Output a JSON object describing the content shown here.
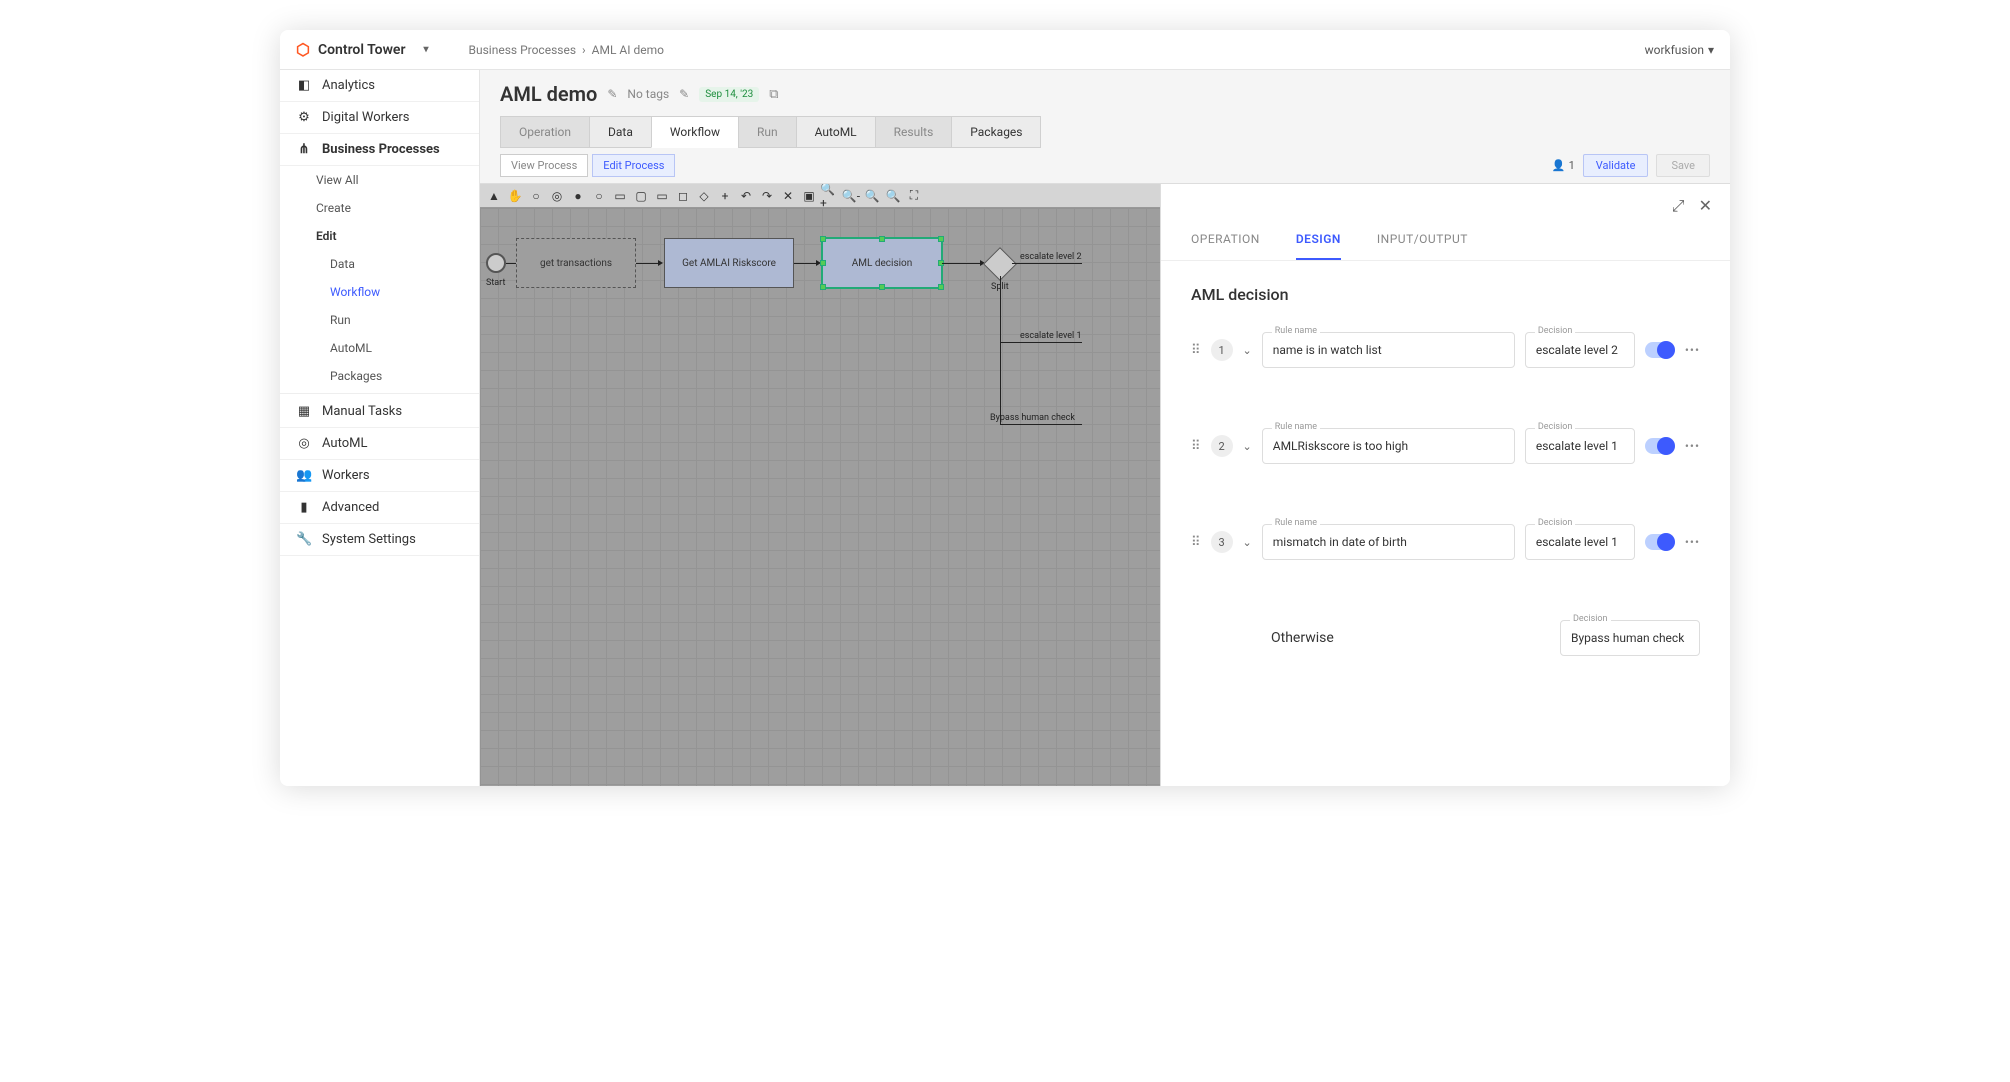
{
  "brand": "Control Tower",
  "breadcrumb": [
    "Business Processes",
    "AML AI demo"
  ],
  "user_menu": "workfusion",
  "sidebar": [
    {
      "icon": "dashboard-icon",
      "glyph": "◧",
      "label": "Analytics"
    },
    {
      "icon": "workers-icon",
      "glyph": "⚙",
      "label": "Digital Workers"
    },
    {
      "icon": "processes-icon",
      "glyph": "⋔",
      "label": "Business Processes",
      "active": true
    },
    {
      "icon": "tasks-icon",
      "glyph": "▦",
      "label": "Manual Tasks"
    },
    {
      "icon": "automl-icon",
      "glyph": "◎",
      "label": "AutoML"
    },
    {
      "icon": "people-icon",
      "glyph": "👥",
      "label": "Workers"
    },
    {
      "icon": "advanced-icon",
      "glyph": "▮",
      "label": "Advanced"
    },
    {
      "icon": "settings-icon",
      "glyph": "🔧",
      "label": "System Settings"
    }
  ],
  "bp_subnav": [
    "View All",
    "Create",
    "Edit"
  ],
  "edit_subnav": [
    "Data",
    "Workflow",
    "Run",
    "AutoML",
    "Packages"
  ],
  "page": {
    "title": "AML demo",
    "notags": "No tags",
    "date": "Sep 14, '23"
  },
  "tabs": [
    "Operation",
    "Data",
    "Workflow",
    "Run",
    "AutoML",
    "Results",
    "Packages"
  ],
  "subactions": {
    "view": "View Process",
    "edit": "Edit Process"
  },
  "toolbar": {
    "user_count": "1",
    "validate": "Validate",
    "save": "Save"
  },
  "flow": {
    "start": "Start",
    "n1": "get transactions",
    "n2": "Get AMLAI Riskscore",
    "n3": "AML decision",
    "split": "Split",
    "e1": "escalate level 2",
    "e2": "escalate level 1",
    "e3": "Bypass human check"
  },
  "panel": {
    "tabs": [
      "OPERATION",
      "DESIGN",
      "INPUT/OUTPUT"
    ],
    "title": "AML decision",
    "labels": {
      "rule_name": "Rule name",
      "decision": "Decision",
      "otherwise": "Otherwise"
    },
    "rules": [
      {
        "num": "1",
        "name": "name is in watch list",
        "decision": "escalate level 2"
      },
      {
        "num": "2",
        "name": "AMLRiskscore is too high",
        "decision": "escalate level 1"
      },
      {
        "num": "3",
        "name": "mismatch in date of birth",
        "decision": "escalate level 1"
      }
    ],
    "otherwise_decision": "Bypass human check"
  }
}
